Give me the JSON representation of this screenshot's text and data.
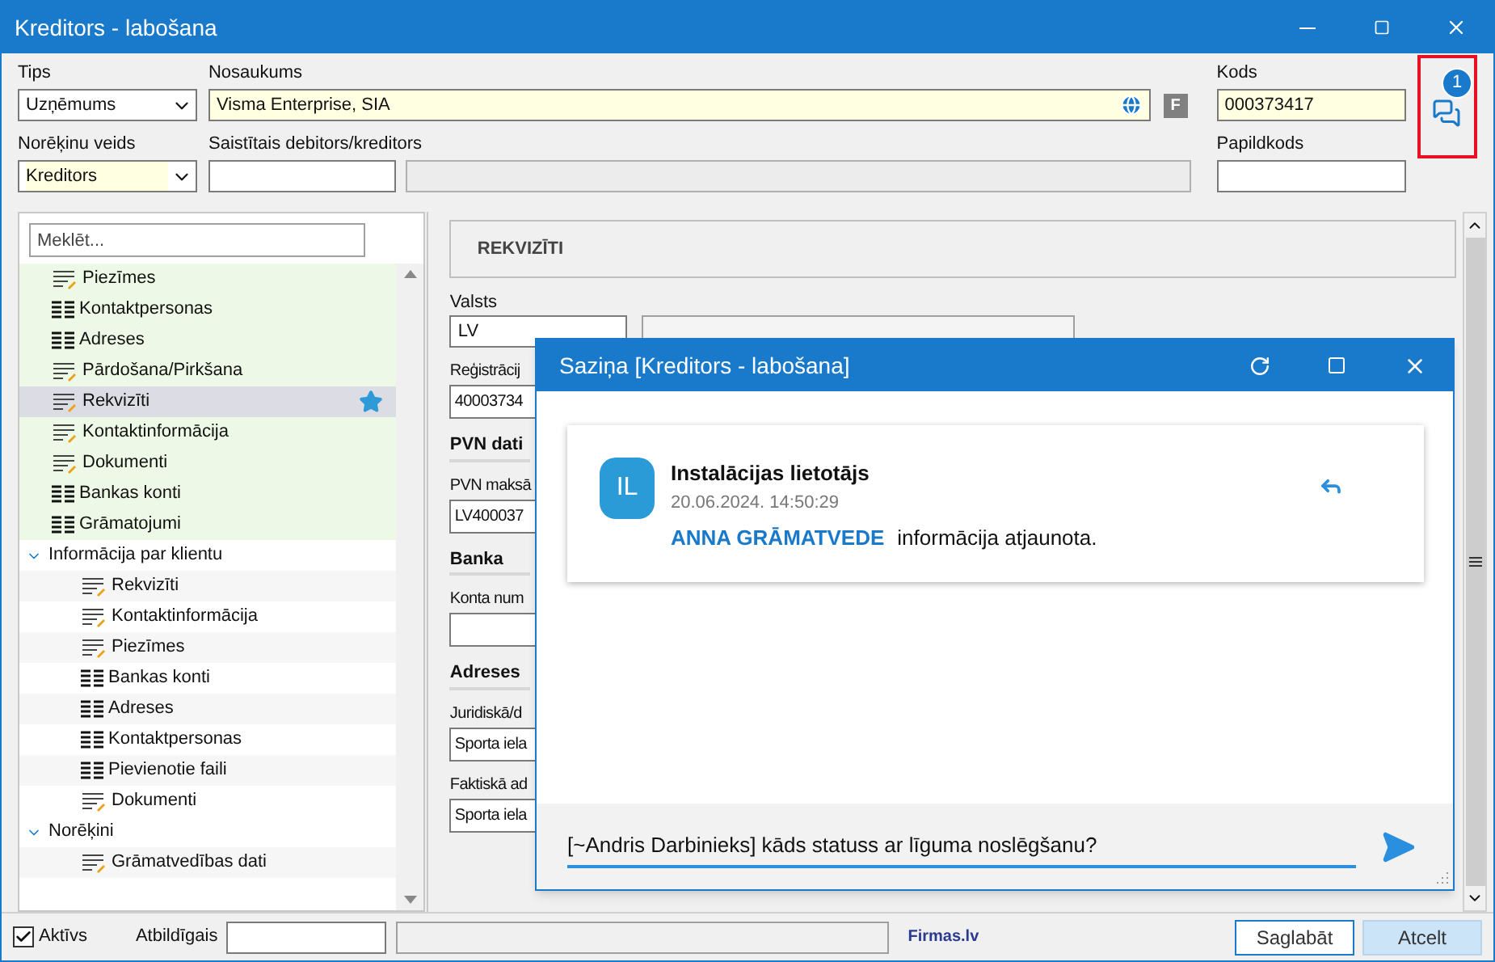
{
  "window": {
    "title": "Kreditors - labošana"
  },
  "header": {
    "tips": {
      "label": "Tips",
      "value": "Uzņēmums"
    },
    "nosaukums": {
      "label": "Nosaukums",
      "value": "Visma Enterprise, SIA",
      "badge": "F"
    },
    "kods": {
      "label": "Kods",
      "value": "000373417"
    },
    "chat_count": "1",
    "norekinu_veids": {
      "label": "Norēķinu veids",
      "value": "Kreditors"
    },
    "saistitais": {
      "label": "Saistītais debitors/kreditors"
    },
    "papildkods": {
      "label": "Papildkods"
    }
  },
  "search": {
    "placeholder": "Meklēt..."
  },
  "tree": {
    "pinned": [
      {
        "label": "Piezīmes",
        "kind": "form",
        "selected": false,
        "favorite": false
      },
      {
        "label": "Kontaktpersonas",
        "kind": "grid",
        "selected": false,
        "favorite": false
      },
      {
        "label": "Adreses",
        "kind": "grid",
        "selected": false,
        "favorite": false
      },
      {
        "label": "Pārdošana/Pirkšana",
        "kind": "form",
        "selected": false,
        "favorite": false
      },
      {
        "label": "Rekvizīti",
        "kind": "form",
        "selected": true,
        "favorite": true
      },
      {
        "label": "Kontaktinformācija",
        "kind": "form",
        "selected": false,
        "favorite": false
      },
      {
        "label": "Dokumenti",
        "kind": "form",
        "selected": false,
        "favorite": false
      },
      {
        "label": "Bankas konti",
        "kind": "grid",
        "selected": false,
        "favorite": false
      },
      {
        "label": "Grāmatojumi",
        "kind": "grid",
        "selected": false,
        "favorite": false
      }
    ],
    "groups": [
      {
        "label": "Informācija par klientu",
        "expanded": true,
        "children": [
          {
            "label": "Rekvizīti",
            "kind": "form"
          },
          {
            "label": "Kontaktinformācija",
            "kind": "form"
          },
          {
            "label": "Piezīmes",
            "kind": "form"
          },
          {
            "label": "Bankas konti",
            "kind": "grid"
          },
          {
            "label": "Adreses",
            "kind": "grid"
          },
          {
            "label": "Kontaktpersonas",
            "kind": "grid"
          },
          {
            "label": "Pievienotie faili",
            "kind": "grid"
          },
          {
            "label": "Dokumenti",
            "kind": "form"
          }
        ]
      },
      {
        "label": "Norēķini",
        "expanded": true,
        "children": [
          {
            "label": "Grāmatvedības dati",
            "kind": "form"
          }
        ]
      }
    ]
  },
  "details": {
    "section_title": "REKVIZĪTI",
    "valsts_label": "Valsts",
    "valsts_value": "LV",
    "rows": [
      {
        "kind": "label",
        "text": "Reģistrācij"
      },
      {
        "kind": "field",
        "text": "40003734"
      },
      {
        "kind": "heading",
        "text": "PVN dati"
      },
      {
        "kind": "label",
        "text": "PVN maksā"
      },
      {
        "kind": "field",
        "text": "LV400037"
      },
      {
        "kind": "heading",
        "text": "Banka"
      },
      {
        "kind": "label",
        "text": "Konta num"
      },
      {
        "kind": "field",
        "text": ""
      },
      {
        "kind": "heading",
        "text": "Adreses"
      },
      {
        "kind": "label",
        "text": "Juridiskā/d"
      },
      {
        "kind": "field",
        "text": "Sporta iela"
      },
      {
        "kind": "label",
        "text": "Faktiskā ad"
      },
      {
        "kind": "field",
        "text": "Sporta iela"
      }
    ]
  },
  "footer": {
    "active": {
      "label": "Aktīvs",
      "checked": true
    },
    "responsible_label": "Atbildīgais",
    "link": "Firmas.lv",
    "buttons": [
      {
        "label": "Saglabāt",
        "kind": "default"
      },
      {
        "label": "Atcelt",
        "kind": "cancel"
      }
    ]
  },
  "dialog": {
    "title": "Saziņa [Kreditors - labošana]",
    "messages": [
      {
        "initials": "IL",
        "author": "Instalācijas lietotājs",
        "time": "20.06.2024. 14:50:29",
        "mention": "ANNA GRĀMATVEDE",
        "text": "informācija atjaunota."
      }
    ],
    "input": {
      "value": "[~Andris Darbinieks] kāds statuss ar līguma noslēgšanu?"
    }
  }
}
